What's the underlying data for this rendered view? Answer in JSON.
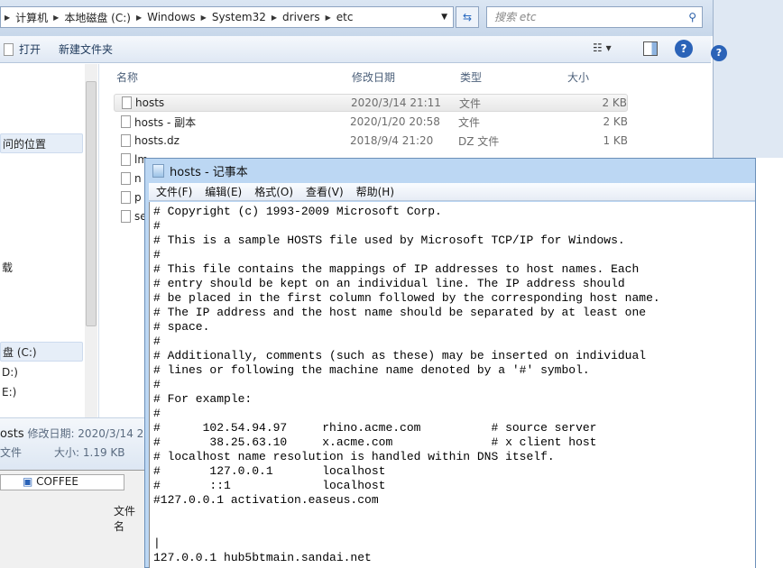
{
  "explorer": {
    "breadcrumb": [
      "计算机",
      "本地磁盘 (C:)",
      "Windows",
      "System32",
      "drivers",
      "etc"
    ],
    "search_placeholder": "搜索 etc",
    "toolbar": {
      "open": "打开",
      "new_folder": "新建文件夹"
    },
    "columns": [
      "名称",
      "修改日期",
      "类型",
      "大小"
    ],
    "files": [
      {
        "name": "hosts",
        "date": "2020/3/14 21:11",
        "type": "文件",
        "size": "2 KB"
      },
      {
        "name": "hosts - 副本",
        "date": "2020/1/20 20:58",
        "type": "文件",
        "size": "2 KB"
      },
      {
        "name": "hosts.dz",
        "date": "2018/9/4 21:20",
        "type": "DZ 文件",
        "size": "1 KB"
      },
      {
        "name": "lm"
      },
      {
        "name": "n"
      },
      {
        "name": "p"
      },
      {
        "name": "se"
      }
    ],
    "nav": [
      "问的位置",
      "载",
      "盘 (C:)",
      "D:)",
      "E:)"
    ],
    "details": {
      "name": "osts",
      "date_label": "修改日期: 2020/3/14 2",
      "type": "文件",
      "size_label": "大小: 1.19 KB"
    },
    "dialog": {
      "location": "COFFEE",
      "filename_label": "文件名"
    }
  },
  "notepad": {
    "title": "hosts - 记事本",
    "menu": [
      "文件(F)",
      "编辑(E)",
      "格式(O)",
      "查看(V)",
      "帮助(H)"
    ],
    "content": "# Copyright (c) 1993-2009 Microsoft Corp.\n#\n# This is a sample HOSTS file used by Microsoft TCP/IP for Windows.\n#\n# This file contains the mappings of IP addresses to host names. Each\n# entry should be kept on an individual line. The IP address should\n# be placed in the first column followed by the corresponding host name.\n# The IP address and the host name should be separated by at least one\n# space.\n#\n# Additionally, comments (such as these) may be inserted on individual\n# lines or following the machine name denoted by a '#' symbol.\n#\n# For example:\n#\n#      102.54.94.97     rhino.acme.com          # source server\n#       38.25.63.10     x.acme.com              # x client host\n# localhost name resolution is handled within DNS itself.\n#       127.0.0.1       localhost\n#       ::1             localhost\n#127.0.0.1 activation.easeus.com\n\n\n|\n127.0.0.1 hub5btmain.sandai.net"
  }
}
